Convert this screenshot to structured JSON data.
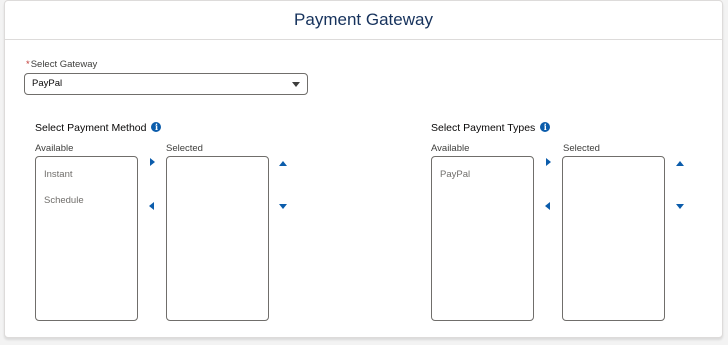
{
  "header": {
    "title": "Payment Gateway"
  },
  "gateway": {
    "required_marker": "*",
    "label": "Select Gateway",
    "value": "PayPal"
  },
  "payment_method": {
    "title": "Select Payment Method",
    "available_label": "Available",
    "selected_label": "Selected",
    "available_items": [
      "Instant",
      "Schedule"
    ],
    "selected_items": []
  },
  "payment_types": {
    "title": "Select Payment Types",
    "available_label": "Available",
    "selected_label": "Selected",
    "available_items": [
      "PayPal"
    ],
    "selected_items": []
  },
  "colors": {
    "accent": "#0b5cab",
    "title": "#16325c",
    "required": "#c23934"
  }
}
